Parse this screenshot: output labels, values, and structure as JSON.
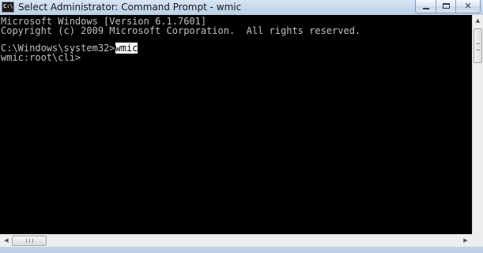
{
  "window": {
    "title": "Select Administrator: Command Prompt - wmic",
    "icon_label": "C:\\",
    "icons": {
      "app": "cmd-icon",
      "minimize": "minimize-icon",
      "maximize": "maximize-icon",
      "close": "close-icon"
    },
    "close_glyph": "✕"
  },
  "console": {
    "line1": "Microsoft Windows [Version 6.1.7601]",
    "line2": "Copyright (c) 2009 Microsoft Corporation.  All rights reserved.",
    "prompt": "C:\\Windows\\system32>",
    "command": "wmic",
    "line5": "wmic:root\\cli>",
    "colors": {
      "background": "#000000",
      "text": "#c0c0c0",
      "selection_bg": "#ffffff",
      "selection_fg": "#000000"
    }
  },
  "scrollbars": {
    "up_arrow": "▲",
    "left_arrow": "◀",
    "right_arrow": "▶",
    "icons": {
      "up": "scroll-up-arrow-icon",
      "left": "scroll-left-arrow-icon",
      "right": "scroll-right-arrow-icon"
    }
  }
}
